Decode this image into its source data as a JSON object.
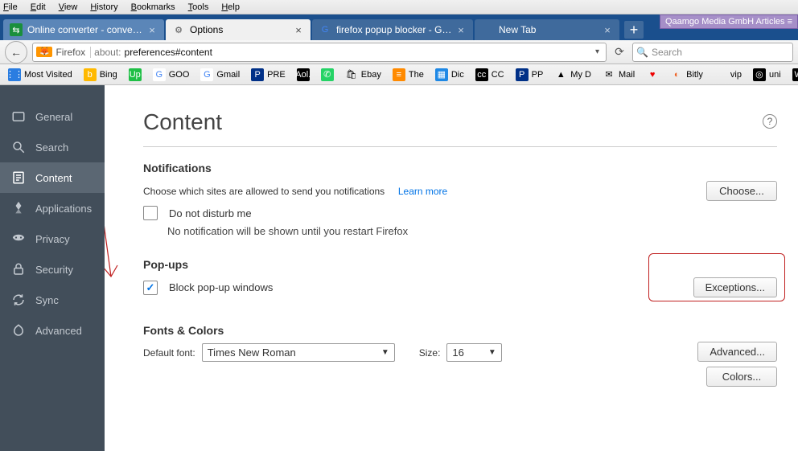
{
  "menubar": [
    "File",
    "Edit",
    "View",
    "History",
    "Bookmarks",
    "Tools",
    "Help"
  ],
  "tabs": [
    {
      "title": "Online converter - convert ...",
      "favicon_bg": "#1a8f3c",
      "favicon_txt": "⇆",
      "active": false
    },
    {
      "title": "Options",
      "favicon_txt": "⚙",
      "favicon_color": "#555",
      "active": true
    },
    {
      "title": "firefox popup blocker - Goo...",
      "favicon_txt": "G",
      "favicon_color": "#4285f4",
      "active": false
    },
    {
      "title": "New Tab",
      "favicon_txt": "",
      "active": false,
      "no_close": false
    }
  ],
  "newtab_label": "+",
  "overlay_badge": "Qaamgo Media GmbH Articles ≡",
  "nav": {
    "firefox_label": "Firefox",
    "url_prefix": "about:",
    "url_rest": "preferences#content",
    "search_placeholder": "Search"
  },
  "bookmarks": [
    {
      "label": "Most Visited",
      "ico": "⋮⋮",
      "bg": "#2a7de1",
      "fg": "#fff"
    },
    {
      "label": "Bing",
      "ico": "b",
      "bg": "#ffb900",
      "fg": "#fff"
    },
    {
      "label": "",
      "ico": "Up",
      "bg": "#1fbf46",
      "fg": "#fff"
    },
    {
      "label": "GOO",
      "ico": "G",
      "bg": "#fff",
      "fg": "#4285f4"
    },
    {
      "label": "Gmail",
      "ico": "G",
      "bg": "#fff",
      "fg": "#4285f4"
    },
    {
      "label": "PRE",
      "ico": "P",
      "bg": "#003087",
      "fg": "#fff"
    },
    {
      "label": "",
      "ico": "Aol.",
      "bg": "#000",
      "fg": "#fff"
    },
    {
      "label": "",
      "ico": "✆",
      "bg": "#25d366",
      "fg": "#fff"
    },
    {
      "label": "Ebay",
      "ico": "🛍",
      "bg": "",
      "fg": ""
    },
    {
      "label": "The",
      "ico": "≡",
      "bg": "#ff8a00",
      "fg": "#fff"
    },
    {
      "label": "Dic",
      "ico": "▦",
      "bg": "#1e88e5",
      "fg": "#fff"
    },
    {
      "label": "CC",
      "ico": "cc",
      "bg": "#000",
      "fg": "#fff"
    },
    {
      "label": "PP",
      "ico": "P",
      "bg": "#003087",
      "fg": "#fff"
    },
    {
      "label": "My D",
      "ico": "▲",
      "bg": "",
      "fg": ""
    },
    {
      "label": "Mail",
      "ico": "✉",
      "bg": "",
      "fg": ""
    },
    {
      "label": "",
      "ico": "♥",
      "bg": "",
      "fg": "#e00"
    },
    {
      "label": "Bitly",
      "ico": "◐",
      "bg": "",
      "fg": "#ee6123"
    },
    {
      "label": "vip",
      "ico": "",
      "bg": "",
      "fg": ""
    },
    {
      "label": "uni",
      "ico": "◎",
      "bg": "#000",
      "fg": "#fff"
    },
    {
      "label": "WC",
      "ico": "W",
      "bg": "#000",
      "fg": "#fff"
    }
  ],
  "sidebar": [
    {
      "label": "General",
      "icon": "general"
    },
    {
      "label": "Search",
      "icon": "search"
    },
    {
      "label": "Content",
      "icon": "content",
      "active": true
    },
    {
      "label": "Applications",
      "icon": "apps"
    },
    {
      "label": "Privacy",
      "icon": "privacy"
    },
    {
      "label": "Security",
      "icon": "security"
    },
    {
      "label": "Sync",
      "icon": "sync"
    },
    {
      "label": "Advanced",
      "icon": "advanced"
    }
  ],
  "page": {
    "title": "Content",
    "notifications": {
      "heading": "Notifications",
      "desc": "Choose which sites are allowed to send you notifications",
      "learn_more": "Learn more",
      "choose_btn": "Choose...",
      "dnd_label": "Do not disturb me",
      "dnd_hint": "No notification will be shown until you restart Firefox"
    },
    "popups": {
      "heading": "Pop-ups",
      "block_label": "Block pop-up windows",
      "exceptions_btn": "Exceptions..."
    },
    "fonts": {
      "heading": "Fonts & Colors",
      "default_font_label": "Default font:",
      "font_value": "Times New Roman",
      "size_label": "Size:",
      "size_value": "16",
      "advanced_btn": "Advanced...",
      "colors_btn": "Colors..."
    }
  }
}
